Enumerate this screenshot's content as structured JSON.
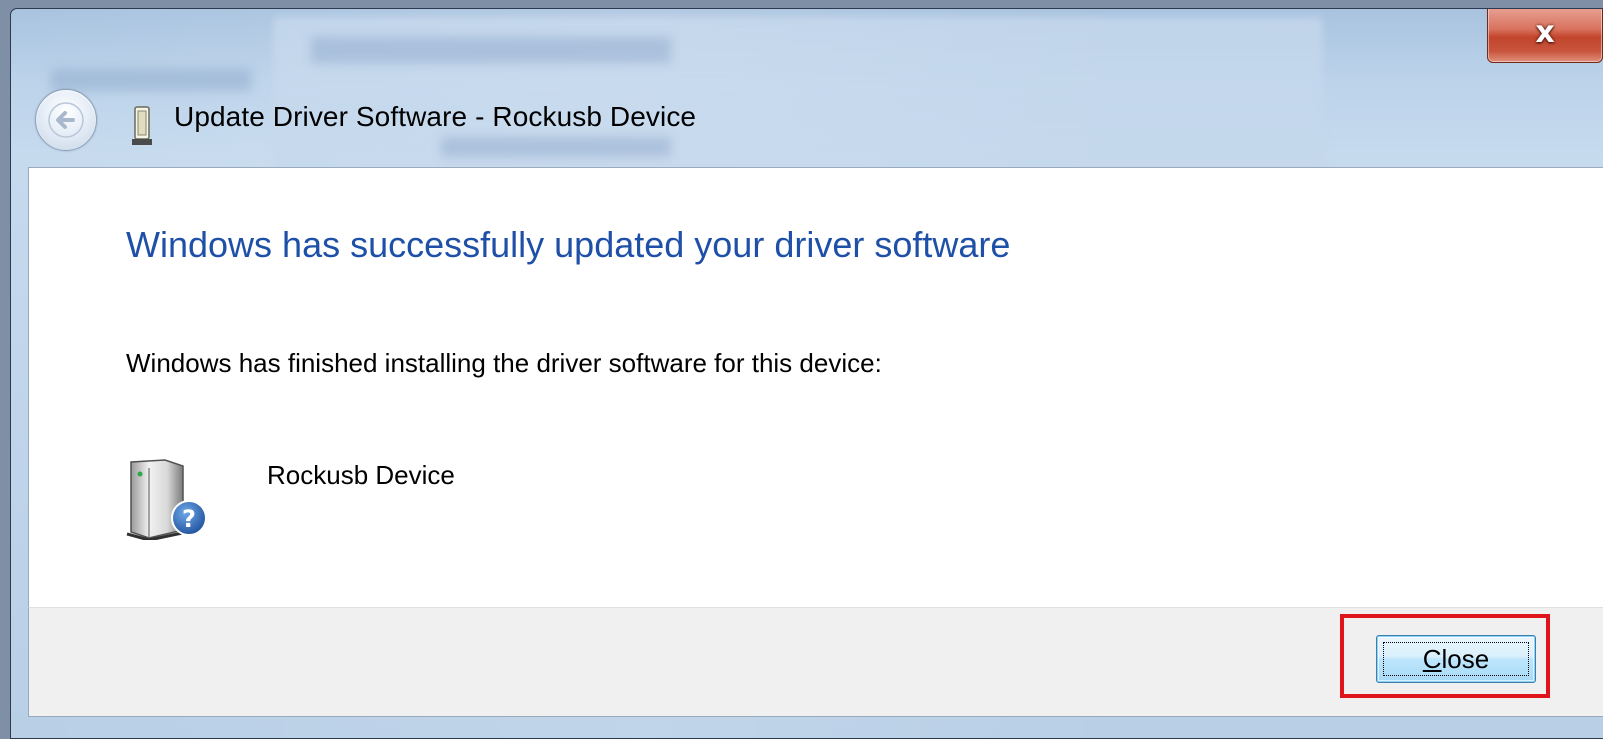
{
  "window": {
    "title": "Update Driver Software - Rockusb Device",
    "caption_close_label": "x"
  },
  "content": {
    "heading": "Windows has successfully updated your driver software",
    "message": "Windows has finished installing the driver software for this device:",
    "device_name": "Rockusb Device"
  },
  "footer": {
    "close_label_mnemonic": "C",
    "close_label_rest": "lose"
  },
  "colors": {
    "heading": "#1e50a8",
    "highlight": "#e0141b",
    "caption_close": "#c8543c"
  },
  "icons": {
    "back": "back-arrow-icon",
    "title": "usb-device-icon",
    "device": "unknown-device-icon"
  }
}
